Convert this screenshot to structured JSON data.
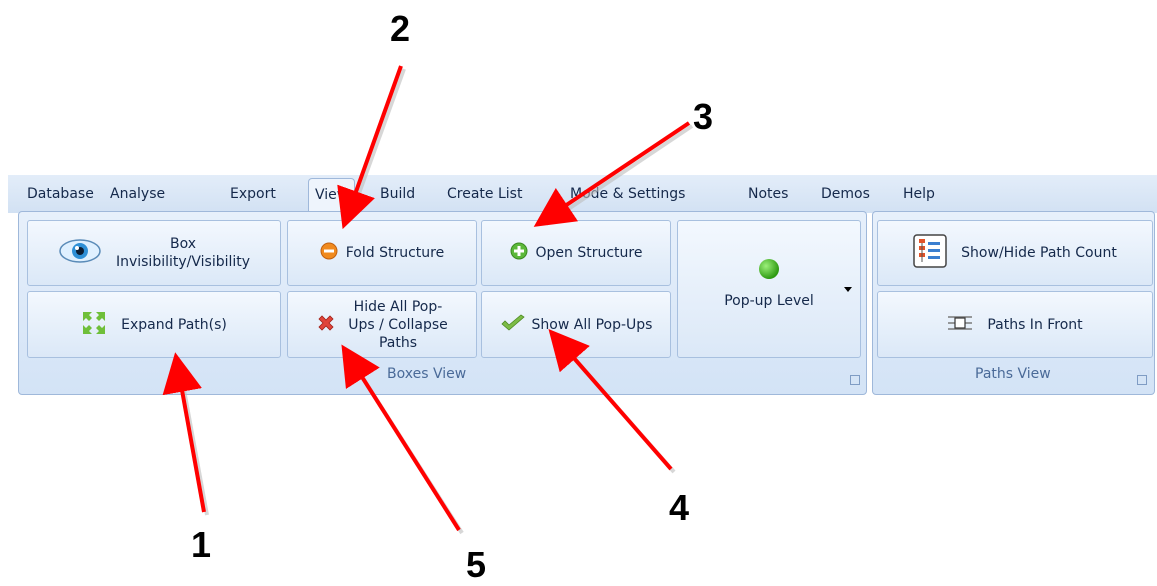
{
  "tabs": [
    "Database",
    "Analyse",
    "Export",
    "View",
    "Build",
    "Create List",
    "Mode & Settings",
    "Notes",
    "Demos",
    "Help"
  ],
  "active_tab": "View",
  "boxes_view": {
    "group_label": "Boxes View",
    "box_visibility_label": "Box\nInvisibility/Visibility",
    "fold_structure_label": "Fold Structure",
    "open_structure_label": "Open Structure",
    "popup_level_label": "Pop-up Level",
    "expand_paths_label": "Expand Path(s)",
    "hide_popups_label": "Hide All Pop-\nUps / Collapse\nPaths",
    "show_popups_label": "Show All Pop-Ups"
  },
  "paths_view": {
    "group_label": "Paths View",
    "path_count_label": "Show/Hide Path Count",
    "paths_in_front_label": "Paths In Front"
  },
  "callouts": [
    "1",
    "2",
    "3",
    "4",
    "5"
  ],
  "colors": {
    "arrow": "#ff0000",
    "accent": "#15294b",
    "ribbon_border": "#9fb8da"
  }
}
